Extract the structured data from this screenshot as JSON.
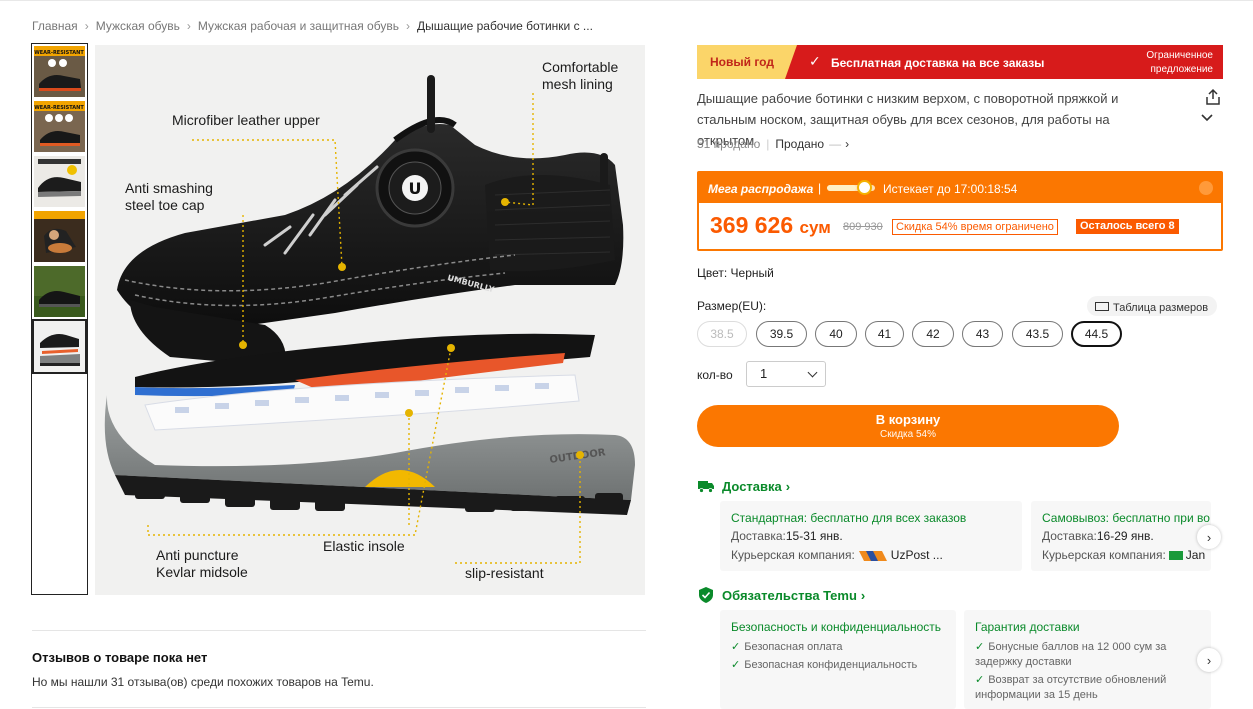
{
  "breadcrumb": {
    "items": [
      "Главная",
      "Мужская обувь",
      "Мужская рабочая и защитная обувь"
    ],
    "current": "Дышащие рабочие ботинки с ..."
  },
  "gallery": {
    "thumbnail_count": 6,
    "active_thumbnail": 6,
    "thumb_banner": "WEAR-RESISTANT"
  },
  "image": {
    "callouts": {
      "mesh": "Comfortable\nmesh lining",
      "upper": "Microfiber leather upper",
      "toe": "Anti smashing\nsteel toe cap",
      "midsole": "Anti puncture\nKevlar midsole",
      "insole": "Elastic insole",
      "slip": "slip-resistant"
    },
    "brand_text": "UMBURLLY",
    "outsole_text": "OUTDOOR",
    "knob_letter": "U"
  },
  "promo": {
    "new_year": "Новый год",
    "free_shipping": "Бесплатная доставка на все заказы",
    "limited": "Ограниченное предложение"
  },
  "product": {
    "title": "Дышащие рабочие ботинки с низким верхом, с поворотной пряжкой и стальным носком, защитная обувь для всех сезонов, для работы на открытом",
    "sold_count": "51 продано",
    "sold_by": "Продано"
  },
  "flash_sale": {
    "label": "Мега распродажа",
    "ends": "Истекает до 17:00:18:54",
    "progress": 0.6,
    "price": "369 626",
    "currency": "сум",
    "old_price": "809 930",
    "discount": "Скидка 54% время ограничено",
    "left": "Осталось всего 8"
  },
  "options": {
    "color_label": "Цвет: Черный",
    "size_label": "Размер(EU):",
    "size_table": "Таблица размеров",
    "sizes": [
      "38.5",
      "39.5",
      "40",
      "41",
      "42",
      "43",
      "43.5",
      "44.5"
    ],
    "disabled_size": "38.5",
    "selected_size": "44.5",
    "qty_label": "кол-во",
    "qty_value": "1"
  },
  "cart": {
    "label": "В корзину",
    "sub": "Скидка 54%"
  },
  "delivery": {
    "heading": "Доставка",
    "standard": {
      "title": "Стандартная: бесплатно для всех заказов",
      "date_label": "Доставка:",
      "date": "15-31 янв.",
      "courier_label": "Курьерская компания:",
      "courier": "UzPost ..."
    },
    "pickup": {
      "title": "Самовывоз: бесплатно при во",
      "date_label": "Доставка:",
      "date": "16-29 янв.",
      "courier_label": "Курьерская компания:",
      "courier": "Jan"
    }
  },
  "commitments": {
    "heading": "Обязательства Temu",
    "security": {
      "title": "Безопасность и конфиденциальность",
      "items": [
        "Безопасная оплата",
        "Безопасная конфиденциальность"
      ]
    },
    "guarantee": {
      "title": "Гарантия доставки",
      "items": [
        "Бонусные баллов на 12 000 сум за задержку доставки",
        "Возврат за отсутствие обновлений информации за 15 день"
      ]
    }
  },
  "reviews": {
    "title": "Отзывов о товаре пока нет",
    "subtitle": "Но мы нашли 31 отзыва(ов) среди похожих товаров на Temu."
  },
  "colors": {
    "accent": "#fb7701",
    "price": "#fb5a01",
    "promo_red": "#d71b1b",
    "green": "#0a8a2a"
  }
}
